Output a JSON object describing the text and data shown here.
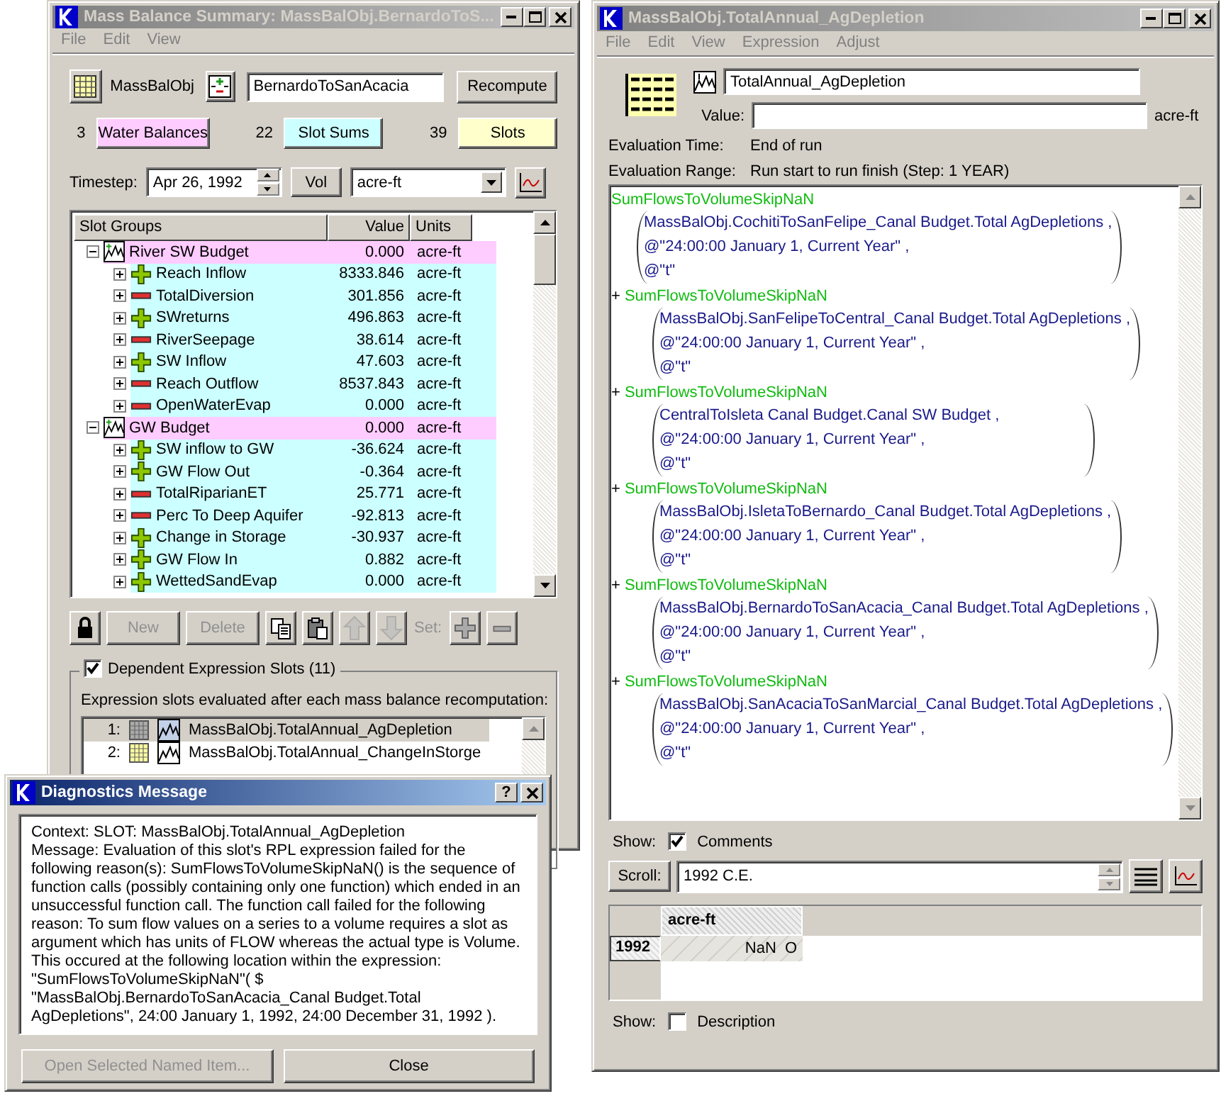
{
  "left_window": {
    "title": "Mass Balance Summary: MassBalObj.BernardoToS...",
    "menu": [
      "File",
      "Edit",
      "View"
    ],
    "object_label": "MassBalObj",
    "object_name": "BernardoToSanAcacia",
    "recompute": "Recompute",
    "counts": [
      {
        "count": "3",
        "label": "Water Balances",
        "color": "#ffccff"
      },
      {
        "count": "22",
        "label": "Slot Sums",
        "color": "#ccffff"
      },
      {
        "count": "39",
        "label": "Slots",
        "color": "#ffffcc"
      }
    ],
    "timestep_label": "Timestep:",
    "timestep": "Apr 26, 1992",
    "vol_button": "Vol",
    "unit": "acre-ft",
    "tree": {
      "columns": [
        "Slot Groups",
        "Value",
        "Units"
      ],
      "groups": [
        {
          "name": "River SW Budget",
          "value": "0.000",
          "units": "acre-ft",
          "expanded": true,
          "children": [
            {
              "name": "Reach Inflow",
              "value": "8333.846",
              "units": "acre-ft",
              "kind": "plus",
              "expanded": false
            },
            {
              "name": "TotalDiversion",
              "value": "301.856",
              "units": "acre-ft",
              "kind": "minus",
              "expanded": false
            },
            {
              "name": "SWreturns",
              "value": "496.863",
              "units": "acre-ft",
              "kind": "plus",
              "expanded": false
            },
            {
              "name": "RiverSeepage",
              "value": "38.614",
              "units": "acre-ft",
              "kind": "minus",
              "expanded": false
            },
            {
              "name": "SW Inflow",
              "value": "47.603",
              "units": "acre-ft",
              "kind": "plus",
              "expanded": false
            },
            {
              "name": "Reach Outflow",
              "value": "8537.843",
              "units": "acre-ft",
              "kind": "minus",
              "expanded": false
            },
            {
              "name": "OpenWaterEvap",
              "value": "0.000",
              "units": "acre-ft",
              "kind": "minus",
              "expanded": false
            }
          ]
        },
        {
          "name": "GW Budget",
          "value": "0.000",
          "units": "acre-ft",
          "expanded": true,
          "children": [
            {
              "name": "SW inflow to GW",
              "value": "-36.624",
              "units": "acre-ft",
              "kind": "plus",
              "expanded": false
            },
            {
              "name": "GW Flow Out",
              "value": "-0.364",
              "units": "acre-ft",
              "kind": "plus",
              "expanded": false
            },
            {
              "name": "TotalRiparianET",
              "value": "25.771",
              "units": "acre-ft",
              "kind": "minus",
              "expanded": false
            },
            {
              "name": "Perc To Deep Aquifer",
              "value": "-92.813",
              "units": "acre-ft",
              "kind": "minus",
              "expanded": false
            },
            {
              "name": "Change in Storage",
              "value": "-30.937",
              "units": "acre-ft",
              "kind": "plus",
              "expanded": false
            },
            {
              "name": "GW Flow In",
              "value": "0.882",
              "units": "acre-ft",
              "kind": "plus",
              "expanded": false
            },
            {
              "name": "WettedSandEvap",
              "value": "0.000",
              "units": "acre-ft",
              "kind": "plus",
              "expanded": false
            }
          ]
        }
      ]
    },
    "toolbar": [
      {
        "kind": "lock",
        "disabled": false
      },
      {
        "kind": "text",
        "label": "New",
        "disabled": true
      },
      {
        "kind": "text",
        "label": "Delete",
        "disabled": true
      },
      {
        "kind": "copy",
        "disabled": false
      },
      {
        "kind": "paste",
        "disabled": false
      },
      {
        "kind": "up",
        "disabled": true
      },
      {
        "kind": "down",
        "disabled": true
      },
      {
        "kind": "label",
        "label": "Set:",
        "disabled": true
      },
      {
        "kind": "plus",
        "disabled": false
      },
      {
        "kind": "minus",
        "disabled": false
      }
    ],
    "dependent": {
      "checked": true,
      "title": "Dependent Expression Slots (11)",
      "description": "Expression slots evaluated after each mass balance recomputation:",
      "items": [
        {
          "index": "1:",
          "name": "MassBalObj.TotalAnnual_AgDepletion",
          "selected": true
        },
        {
          "index": "2:",
          "name": "MassBalObj.TotalAnnual_ChangeInStorge",
          "selected": false
        }
      ]
    }
  },
  "right_window": {
    "title": "MassBalObj.TotalAnnual_AgDepletion",
    "menu": [
      "File",
      "Edit",
      "View",
      "Expression",
      "Adjust"
    ],
    "slot_name": "TotalAnnual_AgDepletion",
    "value_label": "Value:",
    "units": "acre-ft",
    "evaluation": [
      {
        "label": "Evaluation Time:",
        "value": "End of run"
      },
      {
        "label": "Evaluation Range:",
        "value": "Run start to run finish (Step: 1 YEAR)"
      }
    ],
    "expression": [
      {
        "function": "SumFlowsToVolumeSkipNaN",
        "args": [
          "MassBalObj.CochitiToSanFelipe_Canal Budget.Total AgDepletions ,",
          "@\"24:00:00 January 1, Current Year\" ,",
          "@\"t\""
        ]
      },
      {
        "operator": "+",
        "function": "SumFlowsToVolumeSkipNaN",
        "args": [
          "MassBalObj.SanFelipeToCentral_Canal Budget.Total AgDepletions ,",
          "@\"24:00:00 January 1, Current Year\" ,",
          "@\"t\""
        ]
      },
      {
        "operator": "+",
        "function": "SumFlowsToVolumeSkipNaN",
        "args": [
          "CentralToIsleta Canal Budget.Canal SW Budget ,",
          "@\"24:00:00 January 1, Current Year\" ,",
          "@\"t\""
        ]
      },
      {
        "operator": "+",
        "function": "SumFlowsToVolumeSkipNaN",
        "args": [
          "MassBalObj.IsletaToBernardo_Canal Budget.Total AgDepletions ,",
          "@\"24:00:00 January 1, Current Year\" ,",
          "@\"t\""
        ]
      },
      {
        "operator": "+",
        "function": "SumFlowsToVolumeSkipNaN",
        "args": [
          "MassBalObj.BernardoToSanAcacia_Canal Budget.Total AgDepletions ,",
          "@\"24:00:00 January 1, Current Year\" ,",
          "@\"t\""
        ]
      },
      {
        "operator": "+",
        "function": "SumFlowsToVolumeSkipNaN",
        "args": [
          "MassBalObj.SanAcaciaToSanMarcial_Canal Budget.Total AgDepletions ,",
          "@\"24:00:00 January 1, Current Year\" ,",
          "@\"t\""
        ]
      }
    ],
    "show_comments": {
      "label": "Show:",
      "option": "Comments",
      "checked": true
    },
    "scroll_button": "Scroll:",
    "scroll_value": "1992 C.E.",
    "table": {
      "column": "acre-ft",
      "rows": [
        {
          "label": "1992",
          "value": "NaN",
          "flag": "O"
        }
      ]
    },
    "show_description": {
      "label": "Show:",
      "option": "Description",
      "checked": false
    }
  },
  "dialog": {
    "title": "Diagnostics Message",
    "help": "?",
    "context": "Context: SLOT: MassBalObj.TotalAnnual_AgDepletion",
    "message": "Message: Evaluation of this slot's RPL expression failed for the following reason(s): SumFlowsToVolumeSkipNaN() is the sequence of function calls (possibly containing only one function) which ended in an unsuccessful function call. The function call failed for the following reason: To sum flow values on a series to a volume requires a slot as argument which has units of FLOW whereas the actual type is Volume. This occured at the following location within the expression: \"SumFlowsToVolumeSkipNaN\"( $ \"MassBalObj.BernardoToSanAcacia_Canal Budget.Total AgDepletions\", 24:00 January 1, 1992, 24:00 December 31, 1992 ).",
    "buttons": [
      {
        "label": "Open Selected Named Item...",
        "disabled": true
      },
      {
        "label": "Close",
        "disabled": false
      }
    ]
  }
}
